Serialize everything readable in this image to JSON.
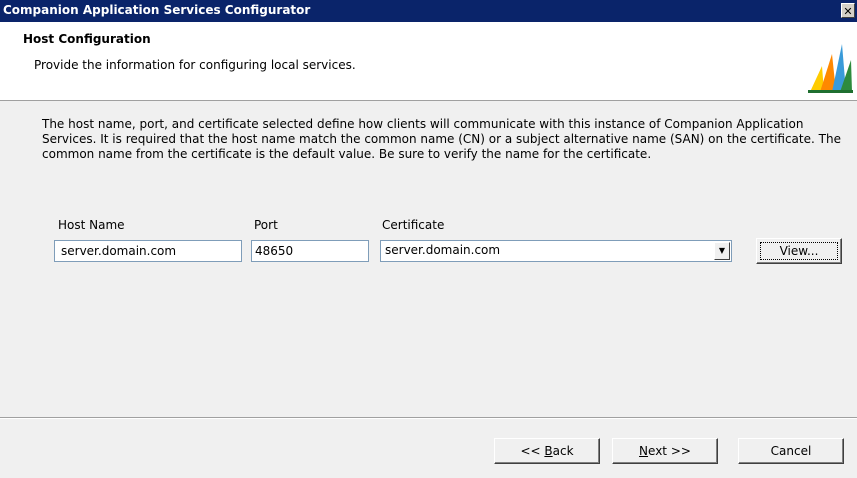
{
  "window": {
    "title": "Companion Application Services Configurator",
    "close_glyph": "✕"
  },
  "header": {
    "title": "Host Configuration",
    "subtitle": "Provide the information for configuring local services.",
    "logo_icon": "dynamics-logo-icon"
  },
  "description": "The host name, port, and certificate selected define how clients will communicate with this instance of Companion Application Services. It is required that the host name match the common name (CN) or a subject alternative name (SAN) on the certificate.  The common name from the certificate is the default value.  Be sure to verify the name for the certificate.",
  "form": {
    "host_name_label": "Host Name",
    "host_name_value": "server.domain.com",
    "port_label": "Port",
    "port_value": "48650",
    "certificate_label": "Certificate",
    "certificate_value": "server.domain.com",
    "view_button": "View..."
  },
  "buttons": {
    "back_prefix": "<< ",
    "back_accel": "B",
    "back_rest": "ack",
    "next_accel": "N",
    "next_rest": "ext >>",
    "cancel": "Cancel"
  },
  "colors": {
    "titlebar": "#0a246a",
    "logo_colors": [
      "#ffcc00",
      "#ff8800",
      "#3a9bd9",
      "#2e8b3d"
    ]
  }
}
